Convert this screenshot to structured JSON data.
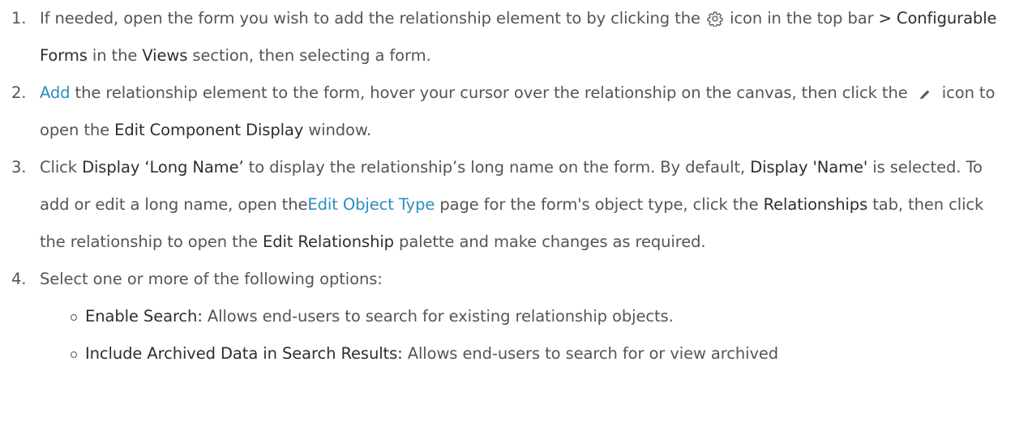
{
  "steps": [
    {
      "num": "1.",
      "t1": "If needed, open the form you wish to add the relationship element to by clicking the ",
      "icon": "gear-icon",
      "t2": " icon in the top bar ",
      "b1": "> Configurable Forms",
      "t3": " in the ",
      "b2": "Views",
      "t4": " section, then selecting a form."
    },
    {
      "num": "2.",
      "link": "Add",
      "t1": " the relationship element to the form, hover your cursor over the relationship on the canvas, then click the ",
      "icon": "pencil-icon",
      "t2": " icon to open the ",
      "b1": "Edit Component Display",
      "t3": " window."
    },
    {
      "num": "3.",
      "t1": "Click ",
      "b1": "Display ‘Long Name’",
      "t2": " to display the relationship’s long name on the form. By default, ",
      "b2": "Display 'Name'",
      "t3": " is selected. To add or edit a long name, open the",
      "link": "Edit Object Type",
      "t4": " page for the form's object type, click the ",
      "b3": "Relationships",
      "t5": " tab, then click the relationship to open the ",
      "b4": "Edit Relationship",
      "t6": " palette and make changes as required."
    },
    {
      "num": "4.",
      "text": "Select one or more of the following options:",
      "options": [
        {
          "label": "Enable Search:",
          "desc": " Allows end-users to search for existing relationship objects."
        },
        {
          "label": "Include Archived Data in Search Results:",
          "desc": " Allows end-users to search for or view archived"
        }
      ]
    }
  ],
  "colors": {
    "body_text": "#555555",
    "strong_text": "#2e2e2e",
    "link": "#2b8ec1"
  }
}
